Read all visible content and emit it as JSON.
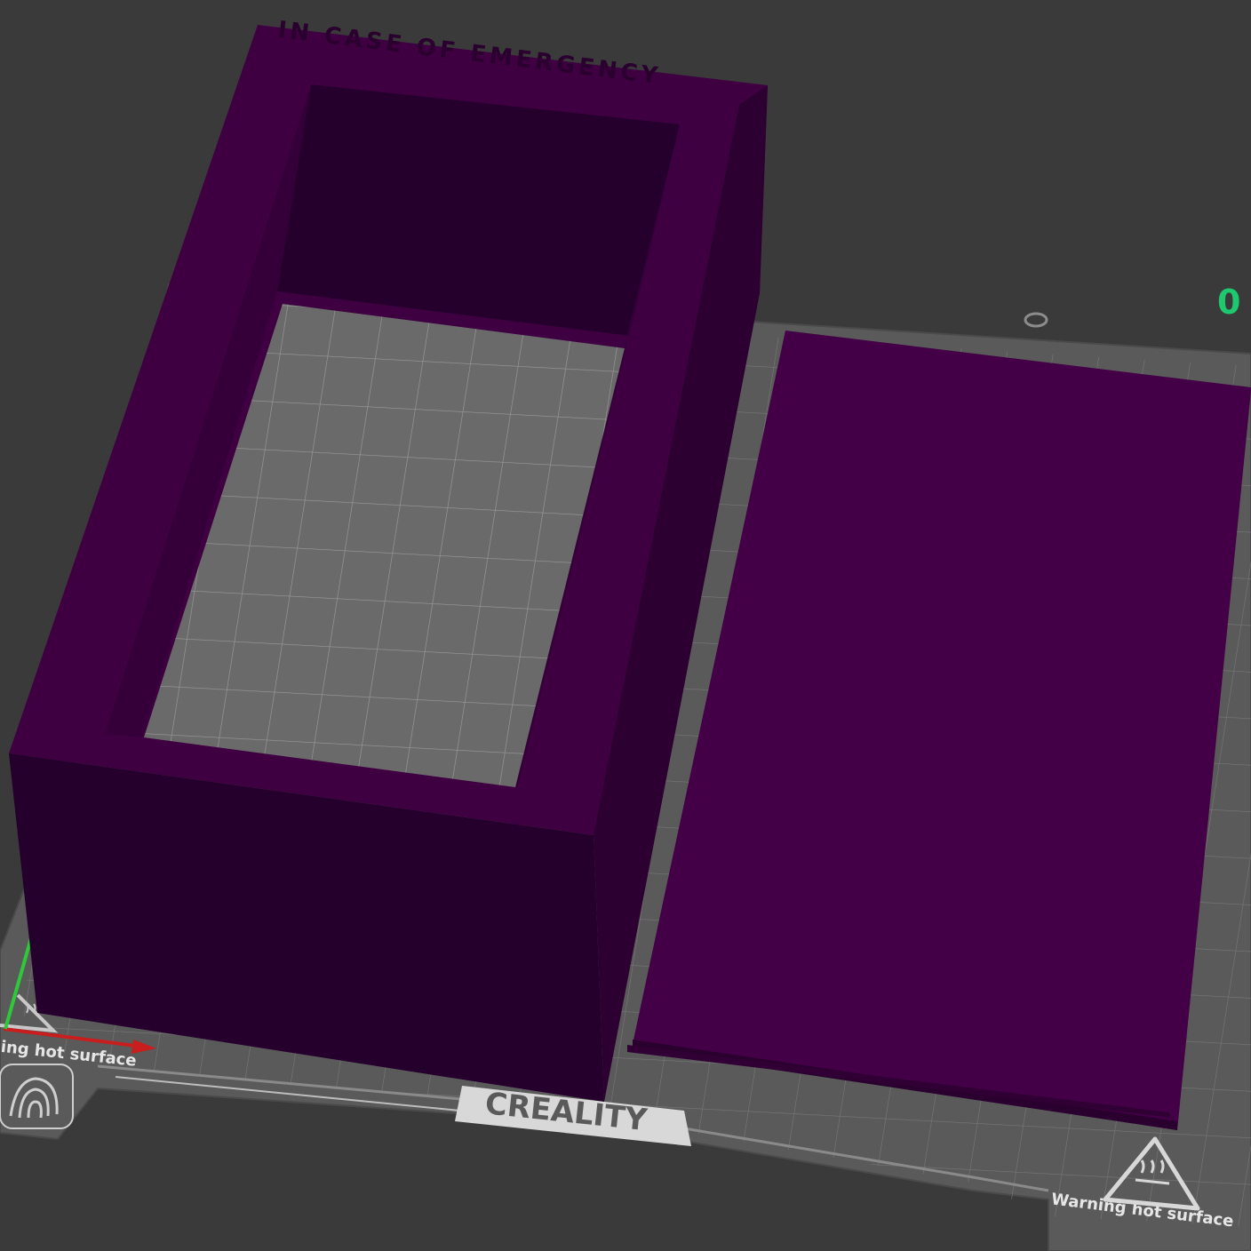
{
  "viewport": {
    "plate_index": "0",
    "bed_brand": "CREALITY",
    "warning_text_left": "ing hot surface",
    "warning_text_right": "Warning hot surface",
    "box_lid_engraving": "IN CASE OF EMERGENCY"
  },
  "colors": {
    "background": "#3a3a3a",
    "bed_plate": "#5a5a5a",
    "bed_grid": "#7b7b7b",
    "model_purple": "#3f0042",
    "model_purple_dark": "#25002c",
    "model_purple_top": "#430047",
    "plate_counter": "#1ec86e",
    "axis_x": "#c81e1e",
    "axis_y": "#2ec83a"
  },
  "icons": [
    "fingerprint-icon",
    "hot-surface-warning-icon"
  ]
}
